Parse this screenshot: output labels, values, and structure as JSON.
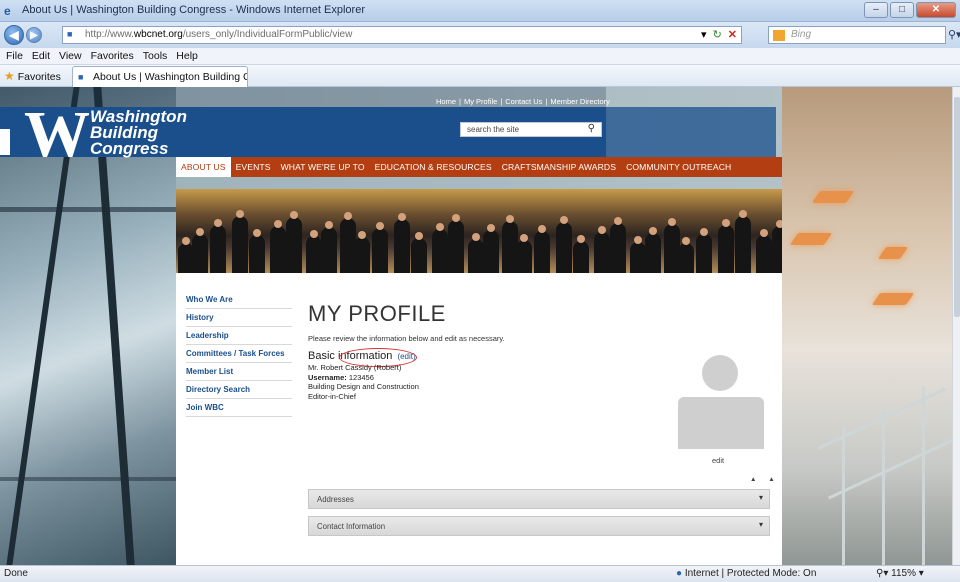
{
  "browser": {
    "window_title": "About Us | Washington Building Congress - Windows Internet Explorer",
    "url_prefix": "http://www.",
    "url_domain": "wbcnet.org",
    "url_path": "/users_only/IndividualFormPublic/view",
    "search_placeholder": "Bing",
    "menu": [
      "File",
      "Edit",
      "View",
      "Favorites",
      "Tools",
      "Help"
    ],
    "favorites_label": "Favorites",
    "tab_title": "About Us | Washington Building Cong...",
    "status_text": "Done",
    "zone_text": "Internet | Protected Mode: On",
    "zoom_text": "115%"
  },
  "site": {
    "logo_line1": "Washington",
    "logo_line2": "Building",
    "logo_line3": "Congress",
    "top_links": [
      "Home",
      "My Profile",
      "Contact Us",
      "Member Directory"
    ],
    "search_placeholder": "search the site",
    "nav": [
      "ABOUT US",
      "EVENTS",
      "WHAT WE'RE UP TO",
      "EDUCATION & RESOURCES",
      "CRAFTSMANSHIP AWARDS",
      "COMMUNITY OUTREACH"
    ],
    "active_nav": "ABOUT US",
    "side_nav": [
      "Who We Are",
      "History",
      "Leadership",
      "Committees / Task Forces",
      "Member List",
      "Directory Search",
      "Join WBC"
    ]
  },
  "profile": {
    "title": "MY PROFILE",
    "intro": "Please review the information below and edit as necessary.",
    "basic_heading": "Basic information",
    "basic_edit": "(edit)",
    "name": "Mr. Robert Cassidy (Robert)",
    "username_label": "Username:",
    "username_value": "123456",
    "company": "Building Design and Construction",
    "position": "Editor-in-Chief",
    "avatar_edit": "edit",
    "expand_controls": "▲ ▲",
    "sections": [
      "Addresses",
      "Contact Information"
    ]
  },
  "colors": {
    "brand_blue": "#1a4f8c",
    "nav_orange": "#b33e12",
    "annotation_red": "#dd3333"
  }
}
